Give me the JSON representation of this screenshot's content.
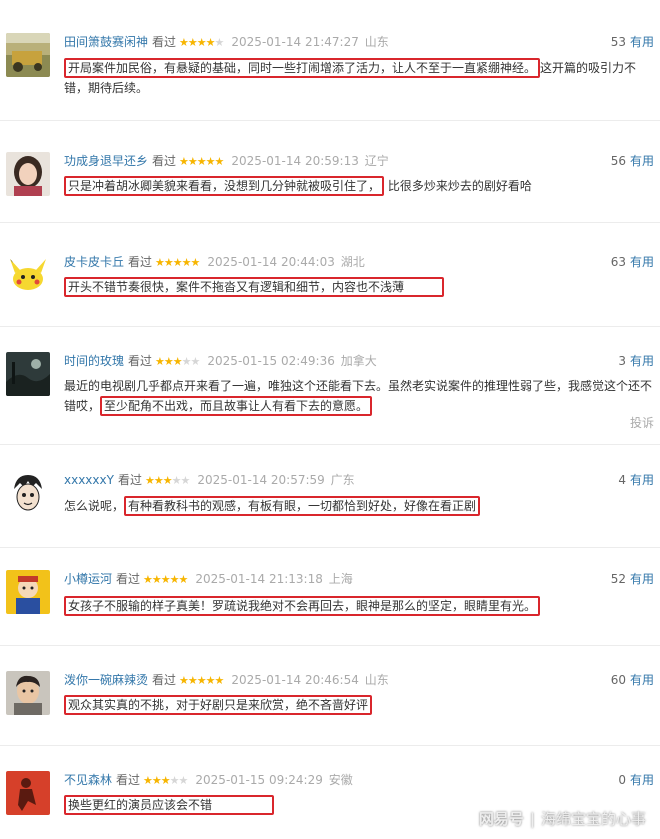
{
  "watched_label": "看过",
  "useful_label": "有用",
  "report_label": "投诉",
  "watermark": {
    "brand": "网易号",
    "separator": "|",
    "author": "海绵宝宝的心事"
  },
  "reviews": [
    {
      "user": "田间箫鼓赛闲神",
      "rating": 4,
      "date": "2025-01-14 21:47:27",
      "location": "山东",
      "votes": "53",
      "text_hl": "开局案件加民俗，有悬疑的基础，同时一些打闹增添了活力，让人不至于一直紧绷神经。",
      "text_rest": "这开篇的吸引力不错，期待后续。",
      "avatar": "field-scene-icon"
    },
    {
      "user": "功成身退早还乡",
      "rating": 5,
      "date": "2025-01-14 20:59:13",
      "location": "辽宁",
      "votes": "56",
      "text_hl": "只是冲着胡冰卿美貌来看看，没想到几分钟就被吸引住了，",
      "text_rest": "比很多炒来炒去的剧好看哈",
      "avatar": "woman-portrait-icon"
    },
    {
      "user": "皮卡皮卡丘",
      "rating": 5,
      "date": "2025-01-14 20:44:03",
      "location": "湖北",
      "votes": "63",
      "text_hl": "开头不错节奏很快，案件不拖沓又有逻辑和细节，内容也不浅薄",
      "text_rest": "",
      "avatar": "pikachu-icon"
    },
    {
      "user": "时间的玫瑰",
      "rating": 3,
      "date": "2025-01-15 02:49:36",
      "location": "加拿大",
      "votes": "3",
      "text_pre": "最近的电视剧几乎都点开来看了一遍，唯独这个还能看下去。虽然老实说案件的推理性弱了些，我感觉这个还不错哎，",
      "text_hl": "至少配角不出戏，而且故事让人有看下去的意愿。",
      "avatar": "dark-landscape-icon"
    },
    {
      "user": "xxxxxxY",
      "rating": 3,
      "date": "2025-01-14 20:57:59",
      "location": "广东",
      "votes": "4",
      "text_pre": "怎么说呢，",
      "text_hl": "有种看教科书的观感，有板有眼，一切都恰到好处，好像在看正剧",
      "avatar": "cartoon-face-icon"
    },
    {
      "user": "小樽运河",
      "rating": 5,
      "date": "2025-01-14 21:13:18",
      "location": "上海",
      "votes": "52",
      "text_hl": "女孩子不服输的样子真美！罗疏说我绝对不会再回去，眼神是那么的坚定，眼睛里有光。",
      "avatar": "cartoon-character-icon"
    },
    {
      "user": "泼你一碗麻辣烫",
      "rating": 5,
      "date": "2025-01-14 20:46:54",
      "location": "山东",
      "votes": "60",
      "text_hl": "观众其实真的不挑，对于好剧只是来欣赏，绝不吝啬好评",
      "avatar": "man-portrait-icon"
    },
    {
      "user": "不见森林",
      "rating": 3,
      "date": "2025-01-15 09:24:29",
      "location": "安徽",
      "votes": "0",
      "text_hl": "换些更红的演员应该会不错",
      "avatar": "red-figure-icon"
    }
  ]
}
